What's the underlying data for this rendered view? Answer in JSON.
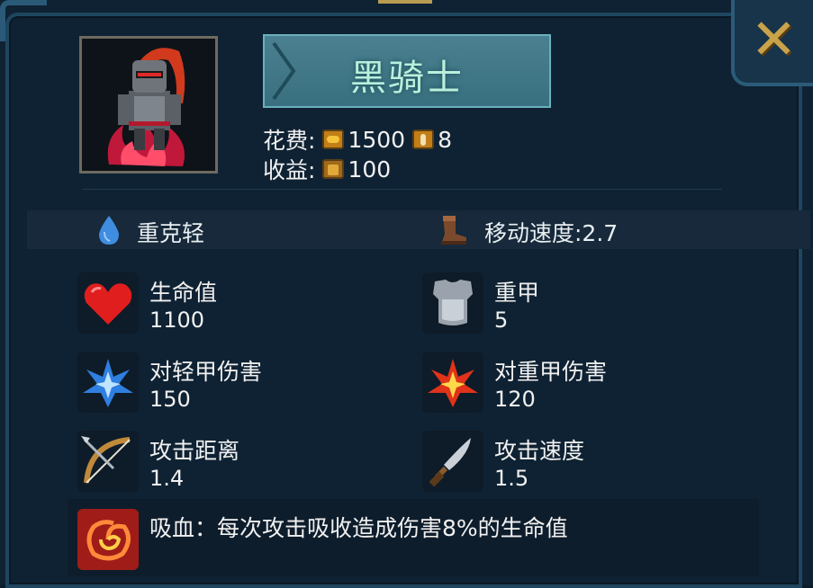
{
  "unit": {
    "name": "黑骑士",
    "portrait_icon": "black-knight-portrait"
  },
  "cost": {
    "label": "花费:",
    "gold": "1500",
    "population": "8"
  },
  "income": {
    "label": "收益:",
    "value": "100"
  },
  "traits": {
    "counter": "重克轻",
    "move_speed": "移动速度:2.7"
  },
  "stats": [
    {
      "label": "生命值",
      "value": "1100",
      "icon": "heart-icon"
    },
    {
      "label": "重甲",
      "value": "5",
      "icon": "armor-icon"
    },
    {
      "label": "对轻甲伤害",
      "value": "150",
      "icon": "blue-burst-icon"
    },
    {
      "label": "对重甲伤害",
      "value": "120",
      "icon": "fire-burst-icon"
    },
    {
      "label": "攻击距离",
      "value": "1.4",
      "icon": "bow-icon"
    },
    {
      "label": "攻击速度",
      "value": "1.5",
      "icon": "dagger-icon"
    }
  ],
  "ability": {
    "text": "吸血：每次攻击吸收造成伤害8%的生命值",
    "icon": "vortex-icon"
  },
  "colors": {
    "banner": "#3f7787",
    "name_text": "#b9f0dc",
    "close": "#c9a24a"
  }
}
